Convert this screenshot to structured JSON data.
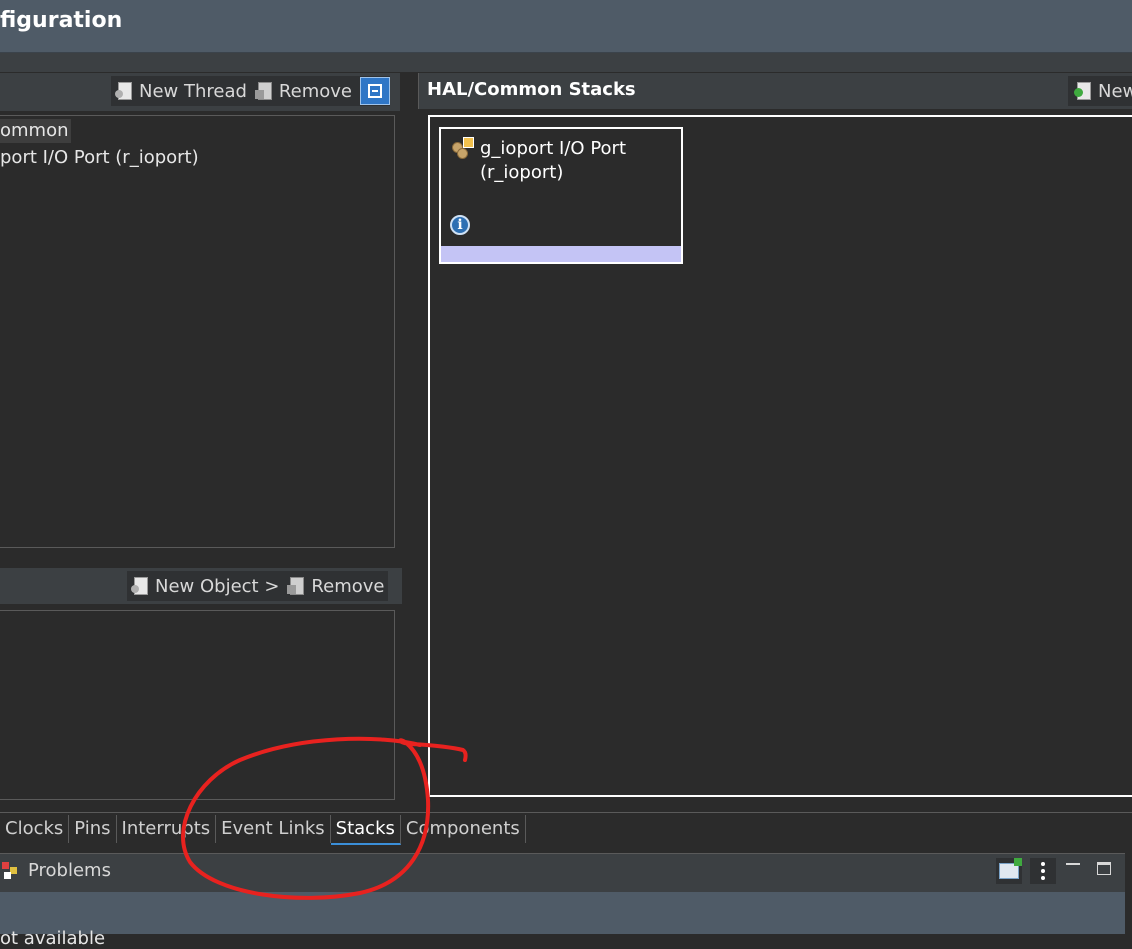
{
  "window": {
    "title": "figuration"
  },
  "threads_panel": {
    "toolbar": {
      "new_thread": "New Thread",
      "remove": "Remove"
    },
    "tree": [
      "ommon",
      "port I/O Port (r_ioport)"
    ]
  },
  "objects_panel": {
    "toolbar": {
      "new_object": "New Object >",
      "remove": "Remove"
    }
  },
  "stacks_panel": {
    "title": "HAL/Common Stacks",
    "toolbar": {
      "new": "New"
    },
    "module": {
      "line1": "g_ioport I/O Port",
      "line2": "(r_ioport)",
      "info_icon_text": "i"
    }
  },
  "tabs": {
    "items": [
      "Clocks",
      "Pins",
      "Interrupts",
      "Event Links",
      "Stacks",
      "Components"
    ],
    "active": "Stacks"
  },
  "problems_view": {
    "label": "Problems",
    "status": "ot available"
  },
  "annotation": {
    "color": "#e8221f",
    "shape": "hand-drawn circle around Stacks tab"
  },
  "colors": {
    "title_bar": "#4f5b67",
    "background": "#2b2b2b",
    "selection_bar": "#c4c4f5",
    "active_tab_underline": "#3b8fd9"
  }
}
